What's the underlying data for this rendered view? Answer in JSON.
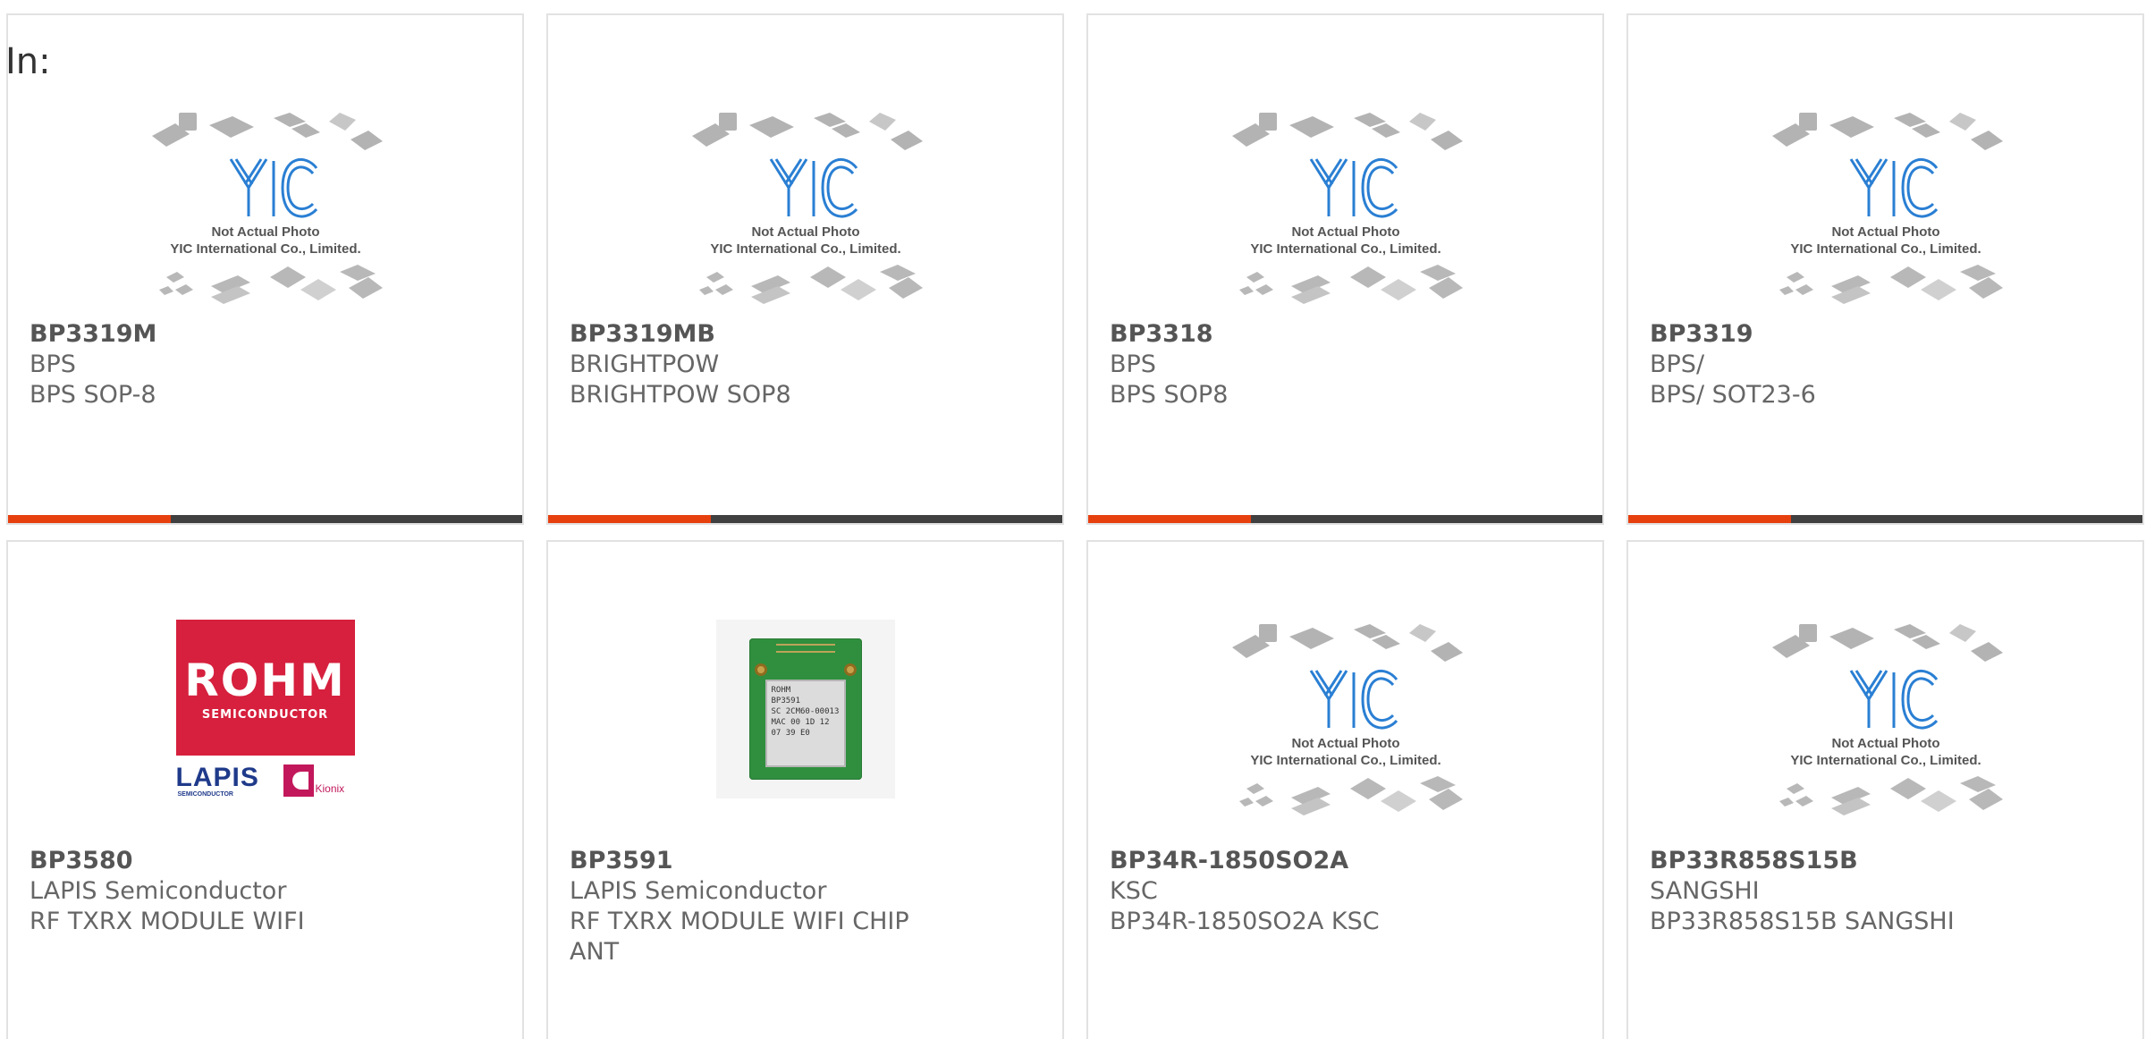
{
  "header": {
    "label": "In:"
  },
  "placeholder": {
    "brand": "YIC",
    "line1": "Not Actual Photo",
    "line2": "YIC International Co., Limited."
  },
  "rohm_logo": {
    "name": "ROHM",
    "tagline": "SEMICONDUCTOR",
    "lapis": "LAPIS",
    "lapis_sub": "SEMICONDUCTOR",
    "kionix": "Kionix"
  },
  "module_photo": {
    "brand": "ROHM",
    "part": "BP3591",
    "code": "SC 2CM60-00013",
    "mac": "MAC 00 1D 12 07 39 E0"
  },
  "colors": {
    "accent": "#e7400f",
    "bar": "#404040",
    "border": "#e2e2e2",
    "rohm_red": "#d6203e"
  },
  "products": [
    {
      "part": "BP3319M",
      "maker": "BPS",
      "desc": "BPS SOP-8",
      "image": "placeholder"
    },
    {
      "part": "BP3319MB",
      "maker": "BRIGHTPOW",
      "desc": "BRIGHTPOW SOP8",
      "image": "placeholder"
    },
    {
      "part": "BP3318",
      "maker": "BPS",
      "desc": "BPS SOP8",
      "image": "placeholder"
    },
    {
      "part": "BP3319",
      "maker": "BPS/",
      "desc": "BPS/ SOT23-6",
      "image": "placeholder"
    },
    {
      "part": "BP3580",
      "maker": "LAPIS Semiconductor",
      "desc": "RF TXRX MODULE WIFI",
      "image": "rohm-logo"
    },
    {
      "part": "BP3591",
      "maker": "LAPIS Semiconductor",
      "desc": "RF TXRX MODULE WIFI CHIP",
      "desc2": "ANT",
      "image": "module"
    },
    {
      "part": "BP34R-1850SO2A",
      "maker": "KSC",
      "desc": "BP34R-1850SO2A KSC",
      "image": "placeholder"
    },
    {
      "part": "BP33R858S15B",
      "maker": "SANGSHI",
      "desc": "BP33R858S15B SANGSHI",
      "image": "placeholder"
    }
  ]
}
